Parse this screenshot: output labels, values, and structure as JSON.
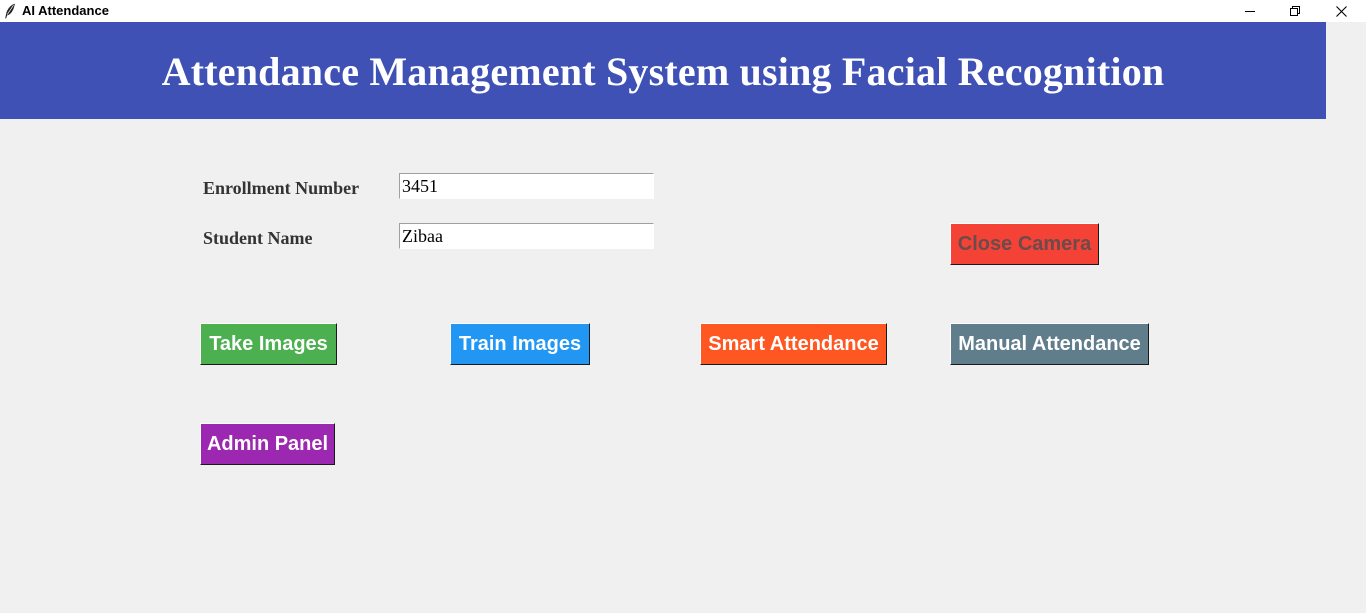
{
  "window": {
    "title": "AI Attendance",
    "icon": "feather-icon",
    "controls": {
      "minimize_icon": "minimize-icon",
      "restore_icon": "restore-icon",
      "close_icon": "close-icon"
    }
  },
  "header": {
    "title": "Attendance Management System using Facial Recognition",
    "background": "#3f51b5"
  },
  "form": {
    "enrollment_label": "Enrollment Number",
    "enrollment_value": "3451",
    "name_label": "Student Name",
    "name_value": "Zibaa"
  },
  "buttons": {
    "close_camera": {
      "label": "Close Camera",
      "color": "#f44336"
    },
    "take_images": {
      "label": "Take Images",
      "color": "#4caf50"
    },
    "train_images": {
      "label": "Train Images",
      "color": "#2196f3"
    },
    "smart_attendance": {
      "label": "Smart Attendance",
      "color": "#ff5722"
    },
    "manual_attendance": {
      "label": "Manual Attendance",
      "color": "#607d8b"
    },
    "admin_panel": {
      "label": "Admin Panel",
      "color": "#9c27b0"
    }
  }
}
